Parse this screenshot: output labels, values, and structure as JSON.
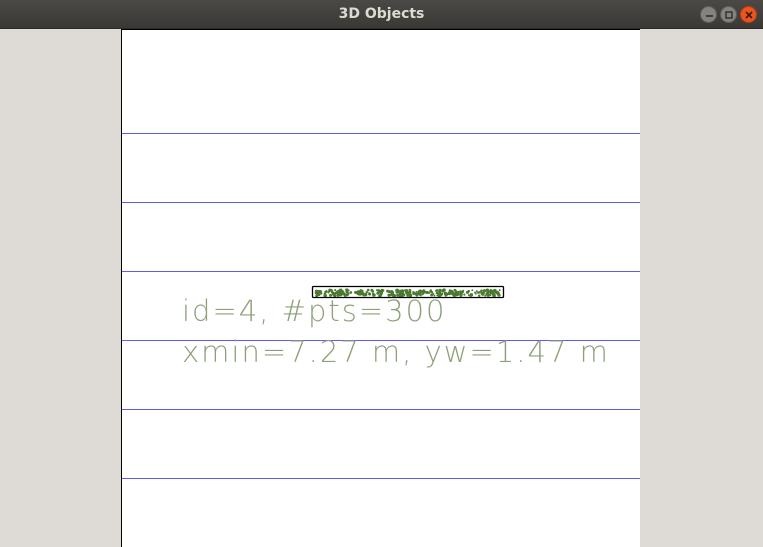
{
  "window": {
    "title": "3D Objects",
    "controls": {
      "minimize_icon": "minimize-icon",
      "maximize_icon": "maximize-icon",
      "close_icon": "close-icon"
    },
    "close_color": "#e95420"
  },
  "view": {
    "gridline_color": "#5c5cf0",
    "point_color": "#4a7a2e",
    "box_color": "#000000",
    "text_color": "#8da07a"
  },
  "object": {
    "label_line1": "id=4, #pts=300",
    "label_line2": "xmin=7.27 m, yw=1.47 m"
  }
}
